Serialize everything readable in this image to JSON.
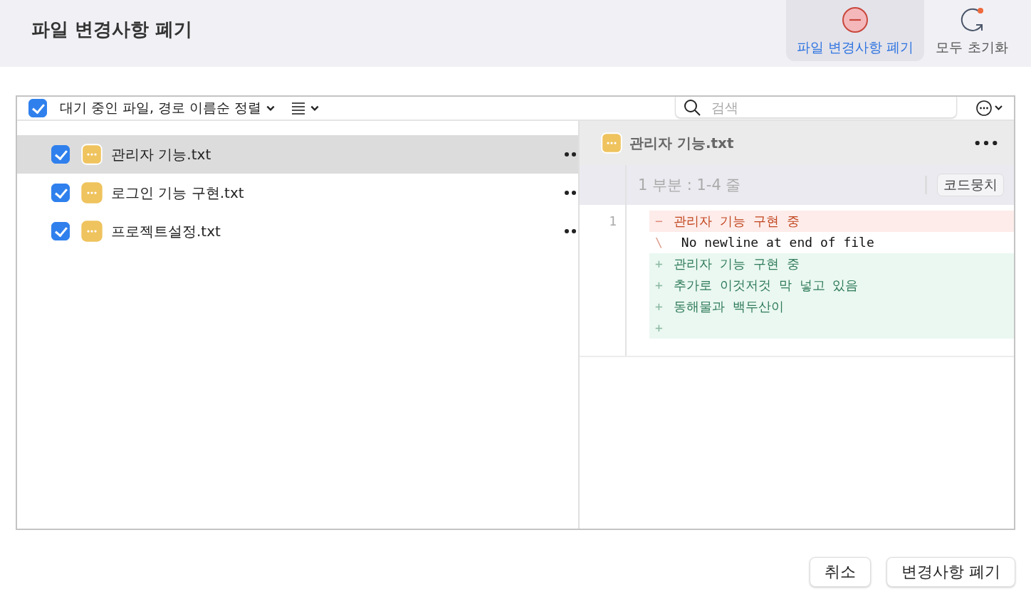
{
  "window": {
    "title": "파일 변경사항 폐기"
  },
  "toolbar": [
    {
      "label": "파일 변경사항 폐기",
      "kind": "discard",
      "selected": true
    },
    {
      "label": "모두 초기화",
      "kind": "reset",
      "selected": false
    }
  ],
  "filter": {
    "checked": true,
    "label": "대기 중인 파일, 경로 이름순 정렬"
  },
  "search": {
    "placeholder": "검색"
  },
  "files": [
    {
      "name": "관리자 기능.txt",
      "checked": true,
      "selected": true
    },
    {
      "name": "로그인 기능 구현.txt",
      "checked": true,
      "selected": false
    },
    {
      "name": "프로젝트설정.txt",
      "checked": true,
      "selected": false
    }
  ],
  "diff": {
    "file": "관리자 기능.txt",
    "hunk": "1 부분 : 1-4 줄",
    "hunk_button": "코드뭉치",
    "lines": [
      {
        "kind": "removed",
        "number": "1",
        "sign": "−",
        "text": "관리자 기능 구현 중"
      },
      {
        "kind": "note",
        "sign": "\\",
        "text": " No newline at end of file"
      },
      {
        "kind": "added",
        "sign": "+",
        "text": "관리자 기능 구현 중"
      },
      {
        "kind": "added",
        "sign": "+",
        "text": "추가로 이것저것 막 넣고 있음"
      },
      {
        "kind": "added",
        "sign": "+",
        "text": "동해물과 백두산이"
      },
      {
        "kind": "added",
        "sign": "+"
      }
    ]
  },
  "buttons": [
    {
      "label": "취소"
    },
    {
      "label": "변경사항 폐기"
    }
  ]
}
